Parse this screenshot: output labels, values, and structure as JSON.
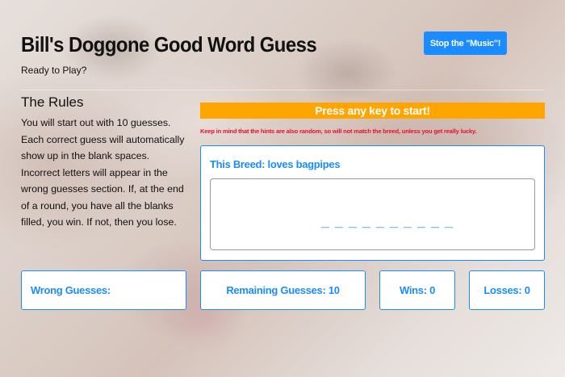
{
  "header": {
    "title": "Bill's Doggone Good Word Guess",
    "subtitle": "Ready to Play?",
    "music_button": "Stop the \"Music\"!"
  },
  "rules": {
    "heading": "The Rules",
    "text": "You will start out with 10 guesses. Each correct guess will automatically show up in the blank spaces. Incorrect letters will appear in the wrong guesses section. If, at the end of a round, you have all the blanks filled, you win. If not, then you lose."
  },
  "game": {
    "start_prompt": "Press any key to start!",
    "hint_note": "Keep in mind that the hints are also random, so will not match the breed, unless you get really lucky.",
    "breed_hint": "This Breed: loves bagpipes",
    "blanks": "_ _ _ _ _ _ _ _ _ _"
  },
  "stats": {
    "wrong_guesses": "Wrong Guesses:",
    "remaining_guesses": "Remaining Guesses: 10",
    "wins": "Wins: 0",
    "losses": "Losses: 0"
  },
  "colors": {
    "accent_blue": "#1a8cff",
    "banner_orange": "#ffa500",
    "hint_red": "#e8102a"
  }
}
